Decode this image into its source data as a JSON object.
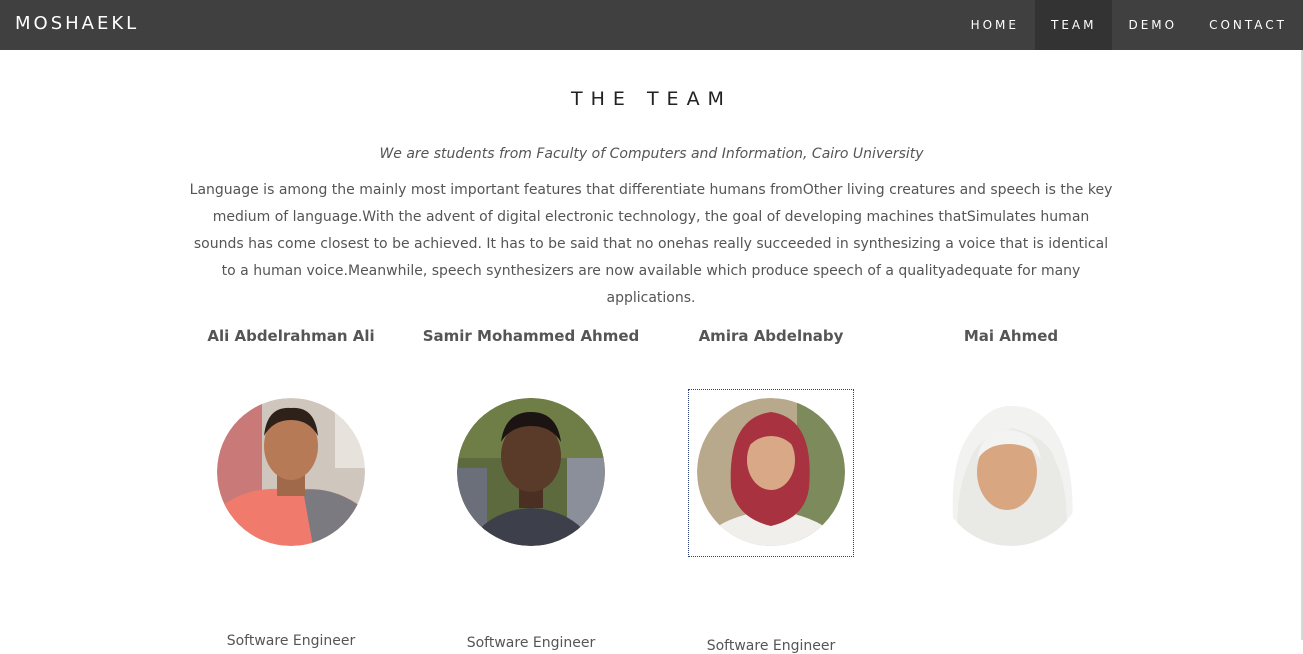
{
  "navbar": {
    "brand": "MOSHAEKL",
    "items": [
      {
        "label": "HOME",
        "active": false
      },
      {
        "label": "TEAM",
        "active": true
      },
      {
        "label": "DEMO",
        "active": false
      },
      {
        "label": "CONTACT",
        "active": false
      }
    ]
  },
  "team": {
    "title": "THE TEAM",
    "subtitle": "We are students from Faculty of Computers and Information, Cairo University",
    "intro": "Language is among the mainly most important features that differentiate humans fromOther living creatures and speech is the key medium of language.With the advent of digital electronic technology, the goal of developing machines thatSimulates human sounds has come closest to be achieved. It has to be said that no onehas really succeeded in synthesizing a voice that is identical to a human voice.Meanwhile, speech synthesizers are now available which produce speech of a qualityadequate for many applications.",
    "members": [
      {
        "name": "Ali Abdelrahman Ali",
        "role": "Software Engineer"
      },
      {
        "name": "Samir Mohammed Ahmed",
        "role": "Software Engineer"
      },
      {
        "name": "Amira Abdelnaby",
        "role": "Software Engineer"
      },
      {
        "name": "Mai Ahmed",
        "role": ""
      }
    ]
  },
  "colors": {
    "navbar_bg": "#404040",
    "nav_active_bg": "#333333",
    "text": "#555555"
  }
}
